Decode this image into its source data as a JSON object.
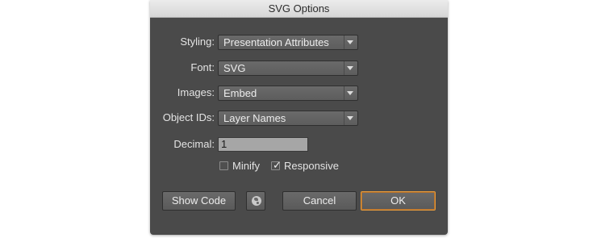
{
  "window": {
    "title": "SVG Options"
  },
  "fields": {
    "styling": {
      "label": "Styling:",
      "value": "Presentation Attributes"
    },
    "font": {
      "label": "Font:",
      "value": "SVG"
    },
    "images": {
      "label": "Images:",
      "value": "Embed"
    },
    "object_ids": {
      "label": "Object IDs:",
      "value": "Layer Names"
    },
    "decimal": {
      "label": "Decimal:",
      "value": "1"
    }
  },
  "options": {
    "minify": {
      "label": "Minify",
      "checked": false
    },
    "responsive": {
      "label": "Responsive",
      "checked": true
    }
  },
  "buttons": {
    "show_code": "Show Code",
    "globe_icon": "globe-icon",
    "cancel": "Cancel",
    "ok": "OK"
  },
  "colors": {
    "dialog_bg": "#4a4a4a",
    "ok_border": "#e39a3c"
  }
}
